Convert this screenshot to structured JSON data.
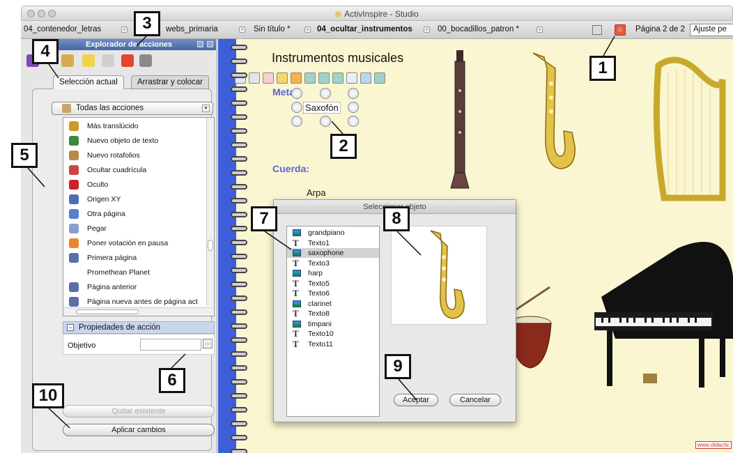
{
  "window": {
    "title": "ActivInspire - Studio"
  },
  "tabs": [
    {
      "label": "04_contenedor_letras"
    },
    {
      "label": "webs_primaria"
    },
    {
      "label": "Sin título *"
    },
    {
      "label": "04_ocultar_instrumentos"
    },
    {
      "label": "00_bocadillos_patron *"
    }
  ],
  "toolbar": {
    "page_label": "Página 2 de 2",
    "zoom_value": "Ajuste pe"
  },
  "explorer": {
    "title": "Explorador de acciones",
    "tab_selection": "Selección actual",
    "tab_drag": "Arrastrar y colocar",
    "filter_value": "Todas las acciones",
    "actions": [
      {
        "label": "Más translúcido",
        "icon": "sphere-icon",
        "color": "#c99b2a"
      },
      {
        "label": "Nuevo objeto de texto",
        "icon": "text-t-icon",
        "color": "#3a8a3a"
      },
      {
        "label": "Nuevo rotafolios",
        "icon": "flipchart-icon",
        "color": "#b58a4a"
      },
      {
        "label": "Ocultar cuadrícula",
        "icon": "grid-icon",
        "color": "#c44"
      },
      {
        "label": "Oculto",
        "icon": "hidden-x-icon",
        "color": "#c22"
      },
      {
        "label": "Origen XY",
        "icon": "origin-icon",
        "color": "#4b6fb5"
      },
      {
        "label": "Otra página",
        "icon": "page-link-icon",
        "color": "#5a7fcf"
      },
      {
        "label": "Pegar",
        "icon": "paste-icon",
        "color": "#8aa0c8"
      },
      {
        "label": "Poner votación en pausa",
        "icon": "pause-icon",
        "color": "#e8862a"
      },
      {
        "label": "Primera página",
        "icon": "first-page-icon",
        "color": "#5a6fa8"
      },
      {
        "label": "Promethean Planet",
        "icon": "planet-icon",
        "color": "#ffffff"
      },
      {
        "label": "Página anterior",
        "icon": "previous-page-icon",
        "color": "#5a6fa8"
      },
      {
        "label": "Página nueva antes de página act",
        "icon": "new-page-icon",
        "color": "#5a6fa8"
      }
    ],
    "props_title": "Propiedades de acción",
    "target_label": "Objetivo",
    "browse_label": "...",
    "remove_label": "Quitar existente",
    "apply_label": "Aplicar cambios"
  },
  "canvas": {
    "title": "Instrumentos musicales",
    "section_wind": "Metal:",
    "section_string": "Cuerda:",
    "label_sax": "Saxofón",
    "label_harp": "Arpa",
    "watermark": "www.didactic"
  },
  "dialog": {
    "title": "Seleccionar objeto",
    "objects": [
      {
        "label": "grandpiano",
        "kind": "image"
      },
      {
        "label": "Texto1",
        "kind": "text"
      },
      {
        "label": "saxophone",
        "kind": "image",
        "selected": true
      },
      {
        "label": "Texto3",
        "kind": "text"
      },
      {
        "label": "harp",
        "kind": "image"
      },
      {
        "label": "Texto5",
        "kind": "text"
      },
      {
        "label": "Texto6",
        "kind": "text"
      },
      {
        "label": "clarinet",
        "kind": "image"
      },
      {
        "label": "Texto8",
        "kind": "text"
      },
      {
        "label": "timpani",
        "kind": "image"
      },
      {
        "label": "Texto10",
        "kind": "text"
      },
      {
        "label": "Texto11",
        "kind": "text"
      }
    ],
    "accept_label": "Aceptar",
    "cancel_label": "Cancelar"
  },
  "callouts": [
    "1",
    "2",
    "3",
    "4",
    "5",
    "6",
    "7",
    "8",
    "9",
    "10"
  ]
}
